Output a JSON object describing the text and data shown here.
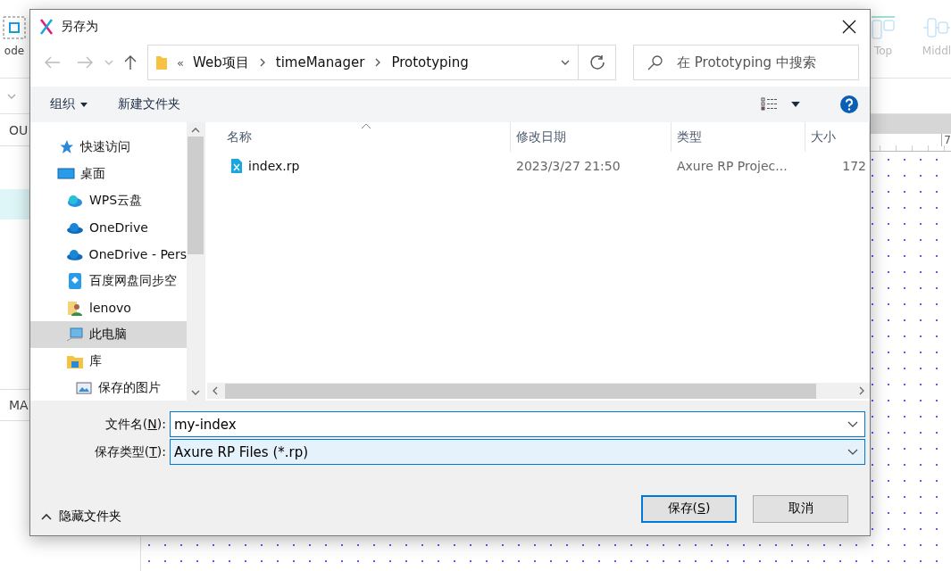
{
  "background_app": {
    "tools": [
      {
        "label": "ode",
        "kind": "select"
      },
      {
        "label": "Top",
        "kind": "align-top"
      },
      {
        "label": "Middl",
        "kind": "align-middle"
      }
    ],
    "panel_headers": [
      "OU",
      "MA"
    ],
    "ruler_label": "7"
  },
  "dialog": {
    "title": "另存为",
    "breadcrumb": {
      "overflow": "«",
      "parts": [
        "Web项目",
        "timeManager",
        "Prototyping"
      ]
    },
    "search": {
      "placeholder": "在 Prototyping 中搜索"
    },
    "commands": [
      {
        "label": "组织",
        "has_menu": true
      },
      {
        "label": "新建文件夹",
        "has_menu": false
      }
    ],
    "nav": [
      {
        "label": "快速访问",
        "kind": "star",
        "selected": false
      },
      {
        "label": "桌面",
        "kind": "desktop",
        "selected": false,
        "children": [
          {
            "label": "WPS云盘",
            "kind": "wps-cloud",
            "selected": false
          },
          {
            "label": "OneDrive",
            "kind": "cloud",
            "selected": false
          },
          {
            "label": "OneDrive - Pers",
            "kind": "cloud",
            "selected": false
          },
          {
            "label": "百度网盘同步空",
            "kind": "baidu",
            "selected": false
          },
          {
            "label": "lenovo",
            "kind": "user",
            "selected": false
          },
          {
            "label": "此电脑",
            "kind": "computer",
            "selected": true
          },
          {
            "label": "库",
            "kind": "library",
            "selected": false,
            "children": [
              {
                "label": "保存的图片",
                "kind": "pictures",
                "selected": false
              }
            ]
          }
        ]
      }
    ],
    "columns": [
      "名称",
      "修改日期",
      "类型",
      "大小"
    ],
    "rows": [
      {
        "name": "index.rp",
        "modified": "2023/3/27 21:50",
        "type": "Axure RP Projec...",
        "size": "172"
      }
    ],
    "fields": [
      {
        "label_parts": [
          "文件名(",
          "N",
          "):"
        ],
        "value": "my-index",
        "highlighted": false
      },
      {
        "label_parts": [
          "保存类型(",
          "T",
          "):"
        ],
        "value": "Axure RP Files (*.rp)",
        "highlighted": true
      }
    ],
    "hide_folders": "隐藏文件夹",
    "buttons": [
      {
        "label_parts": [
          "保存(",
          "S",
          ")"
        ],
        "default": true
      },
      {
        "label_parts": [
          "取消"
        ],
        "default": false
      }
    ]
  }
}
